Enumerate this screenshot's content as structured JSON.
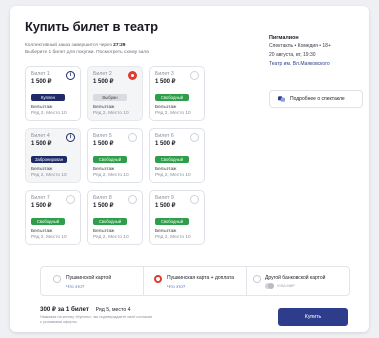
{
  "title": "Купить билет в театр",
  "hints": {
    "timer_prefix": "Коллективный заказ завершится через",
    "timer_value": "27:29",
    "rule": "Выберите 1 билет для покупки. Посмотреть схему зала"
  },
  "seats": [
    {
      "name": "Билет 1",
      "price": "1 500 ₽",
      "status": "Куплен",
      "pill": "navy",
      "control": "info",
      "sector": "Бельэтаж",
      "row": "Ряд 2, Место 10",
      "selected": false
    },
    {
      "name": "Билет 2",
      "price": "1 500 ₽",
      "status": "Выбран",
      "pill": "light",
      "control": "active",
      "sector": "Бельэтаж",
      "row": "Ряд 2, Место 10",
      "selected": true
    },
    {
      "name": "Билет 3",
      "price": "1 500 ₽",
      "status": "Свободный",
      "pill": "green",
      "control": "check",
      "sector": "Бельэтаж",
      "row": "Ряд 2, Место 10",
      "selected": false
    },
    {
      "name": "Билет 4",
      "price": "1 500 ₽",
      "status": "Забронирован",
      "pill": "navy",
      "control": "info",
      "sector": "Бельэтаж",
      "row": "Ряд 2, Место 10",
      "selected": true
    },
    {
      "name": "Билет 5",
      "price": "1 500 ₽",
      "status": "Свободный",
      "pill": "green",
      "control": "check",
      "sector": "Бельэтаж",
      "row": "Ряд 2, Место 10",
      "selected": false
    },
    {
      "name": "Билет 6",
      "price": "1 500 ₽",
      "status": "Свободный",
      "pill": "green",
      "control": "check",
      "sector": "Бельэтаж",
      "row": "Ряд 2, Место 10",
      "selected": false
    },
    {
      "name": "Билет 7",
      "price": "1 500 ₽",
      "status": "Свободный",
      "pill": "green",
      "control": "check",
      "sector": "Бельэтаж",
      "row": "Ряд 2, Место 10",
      "selected": false
    },
    {
      "name": "Билет 8",
      "price": "1 500 ₽",
      "status": "Свободный",
      "pill": "green",
      "control": "check",
      "sector": "Бельэтаж",
      "row": "Ряд 2, Место 10",
      "selected": false
    },
    {
      "name": "Билет 9",
      "price": "1 500 ₽",
      "status": "Свободный",
      "pill": "green",
      "control": "check",
      "sector": "Бельэтаж",
      "row": "Ряд 2, Место 10",
      "selected": false
    }
  ],
  "event": {
    "venue": "Пигмалион",
    "genre": "Спектакль • Комедия • 18+",
    "date": "20 августа, вт, 19:30",
    "theatre": "Театр им. Вл.Маяковского",
    "details_label": "Подробнее о спектакле"
  },
  "payment": {
    "options": [
      {
        "label": "Пушкинской картой",
        "sub": "Что это?",
        "selected": false
      },
      {
        "label": "Пушкинская карта + доплата",
        "sub": "Что это?",
        "selected": true
      },
      {
        "label": "Другой банковской картой",
        "sub": "VISA  МИР",
        "selected": false
      }
    ]
  },
  "summary": {
    "price_line": "300 ₽ за 1 билет",
    "seat_line": "Ряд 5, место 4",
    "note": "Нажимая на кнопку «Купить», вы подтверждаете своё согласие с условиями оферты",
    "buy_label": "Купить"
  },
  "colors": {
    "accent": "#2e3c8c",
    "free": "#2e9e4a",
    "selected": "#e23a2e",
    "booked": "#1f2b68"
  }
}
